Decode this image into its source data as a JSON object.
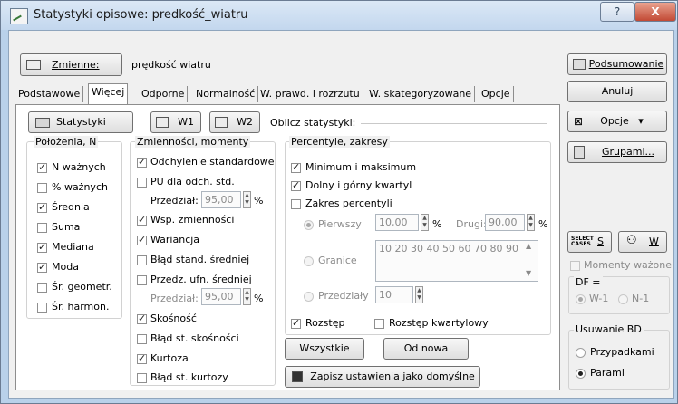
{
  "window": {
    "title": "Statystyki opisowe: predkość_wiatru",
    "help": "?",
    "close": "X"
  },
  "header": {
    "variables_button": "Zmienne:",
    "variable_name": "prędkość wiatru"
  },
  "tabs": [
    "Podstawowe",
    "Więcej",
    "Odporne",
    "Normalność",
    "W. prawd. i rozrzutu",
    "W. skategoryzowane",
    "Opcje"
  ],
  "toolbar": {
    "stats_button": "Statystyki",
    "w1_button": "W1",
    "w2_button": "W2",
    "compute_label": "Oblicz statystyki:"
  },
  "location_group": {
    "title": "Położenia, N",
    "items": [
      {
        "label": "N ważnych",
        "checked": true
      },
      {
        "label": "% ważnych",
        "checked": false
      },
      {
        "label": "Średnia",
        "checked": true
      },
      {
        "label": "Suma",
        "checked": false
      },
      {
        "label": "Mediana",
        "checked": true
      },
      {
        "label": "Moda",
        "checked": true
      },
      {
        "label": "Śr. geometr.",
        "checked": false
      },
      {
        "label": "Śr. harmon.",
        "checked": false
      }
    ]
  },
  "variability_group": {
    "title": "Zmienności, momenty",
    "std_dev": "Odchylenie standardowe",
    "ci_std": "PU dla odch. std.",
    "interval_label": "Przedział:",
    "interval_value": "95,00",
    "interval_unit": "%",
    "range_var": "Wsp. zmienności",
    "variance": "Wariancja",
    "se_mean": "Błąd stand. średniej",
    "ci_mean": "Przedz. ufn. średniej",
    "interval2_label": "Przedział:",
    "interval2_value": "95,00",
    "interval2_unit": "%",
    "skewness": "Skośność",
    "se_skewness": "Błąd st. skośności",
    "kurtosis": "Kurtoza",
    "se_kurtosis": "Błąd st. kurtozy"
  },
  "percentile_group": {
    "title": "Percentyle, zakresy",
    "minmax": "Minimum i maksimum",
    "quartiles": "Dolny i górny kwartyl",
    "range_percentiles": "Zakres percentyli",
    "first_label": "Pierwszy",
    "first_value": "10,00",
    "first_unit": "%",
    "second_label": "Drugi:",
    "second_value": "90,00",
    "second_unit": "%",
    "bounds_label": "Granice",
    "bounds_value": "10 20 30 40 50 60 70 80 90",
    "intervals_label": "Przedziały",
    "intervals_value": "10",
    "range": "Rozstęp",
    "iqr": "Rozstęp kwartylowy"
  },
  "bottom_buttons": {
    "all": "Wszystkie",
    "reset": "Od nowa",
    "save_default": "Zapisz ustawienia jako domyślne"
  },
  "right_panel": {
    "summary": "Podsumowanie",
    "cancel": "Anuluj",
    "options": "Opcje",
    "groups": "Grupami...",
    "select_cases_icon_text": "SELECT CASES",
    "s_label": "S",
    "w_label": "W",
    "weighted_moments": "Momenty ważone",
    "df_label": "DF =",
    "df_w1": "W-1",
    "df_n1": "N-1",
    "missing_title": "Usuwanie BD",
    "missing_casewise": "Przypadkami",
    "missing_pairwise": "Parami"
  }
}
